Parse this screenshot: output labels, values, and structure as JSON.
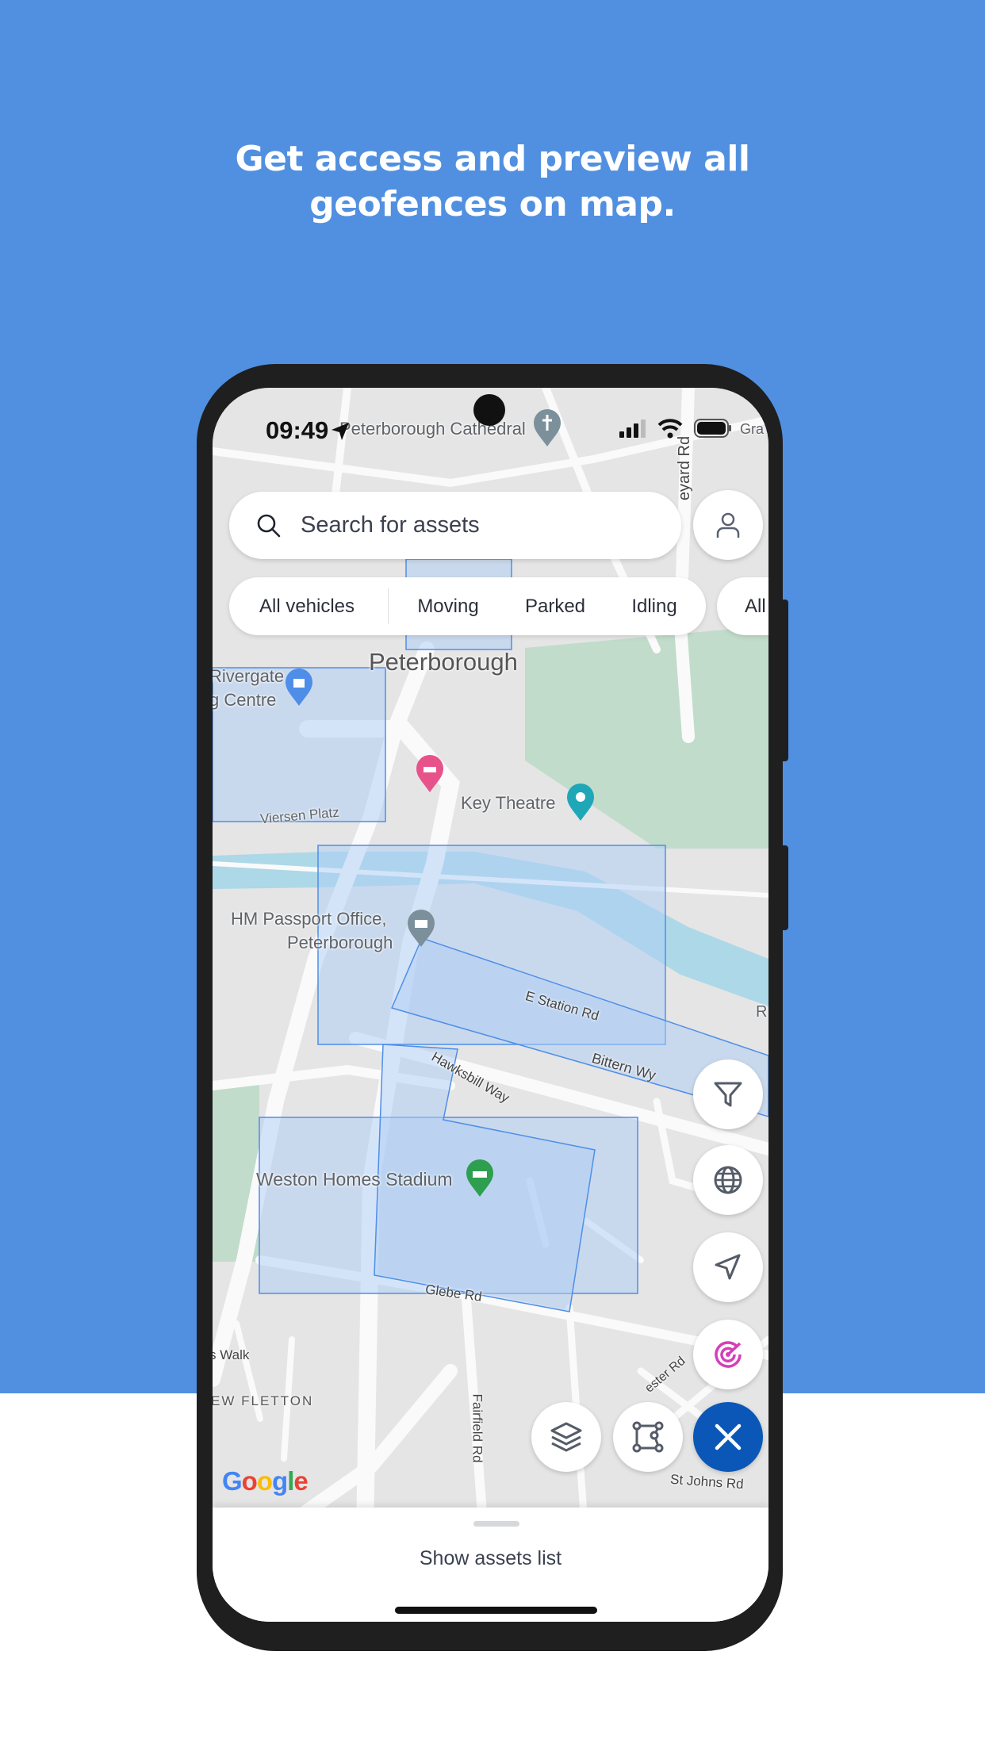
{
  "headline": {
    "line1": "Get access and preview all",
    "line2": "geofences on map."
  },
  "status_bar": {
    "time": "09:49"
  },
  "search": {
    "placeholder": "Search for assets"
  },
  "filters": {
    "chips": [
      "All vehicles",
      "Moving",
      "Parked",
      "Idling"
    ],
    "overflow_chip": "All"
  },
  "map": {
    "labels": {
      "cathedral": "Peterborough Cathedral",
      "city": "Peterborough",
      "rivergate1": "Rivergate",
      "rivergate2": "g Centre",
      "key_theatre": "Key Theatre",
      "viersen": "Viersen Platz",
      "passport1": "HM Passport Office,",
      "passport2": "Peterborough",
      "e_station": "E Station Rd",
      "bittern": "Bittern Wy",
      "hawksbill": "Hawksbill Way",
      "stadium": "Weston Homes Stadium",
      "glebe": "Glebe Rd",
      "walk": "s Walk",
      "fletton": "EW FLETTON",
      "fairfield": "Fairfield Rd",
      "st_johns": "St Johns Rd",
      "vineyard": "eyard Rd",
      "gra": "Gra",
      "r": "R",
      "ester": "ester Rd"
    },
    "attribution": "Google",
    "geofence_color": "#4f8ee8"
  },
  "controls": {
    "icons": [
      "filter-icon",
      "globe-icon",
      "navigation-arrow-icon",
      "target-icon",
      "layers-icon",
      "geofence-draw-icon",
      "close-icon"
    ],
    "accent": "#0b57b8",
    "target_color": "#d63fb8"
  },
  "sheet": {
    "label": "Show assets list"
  }
}
